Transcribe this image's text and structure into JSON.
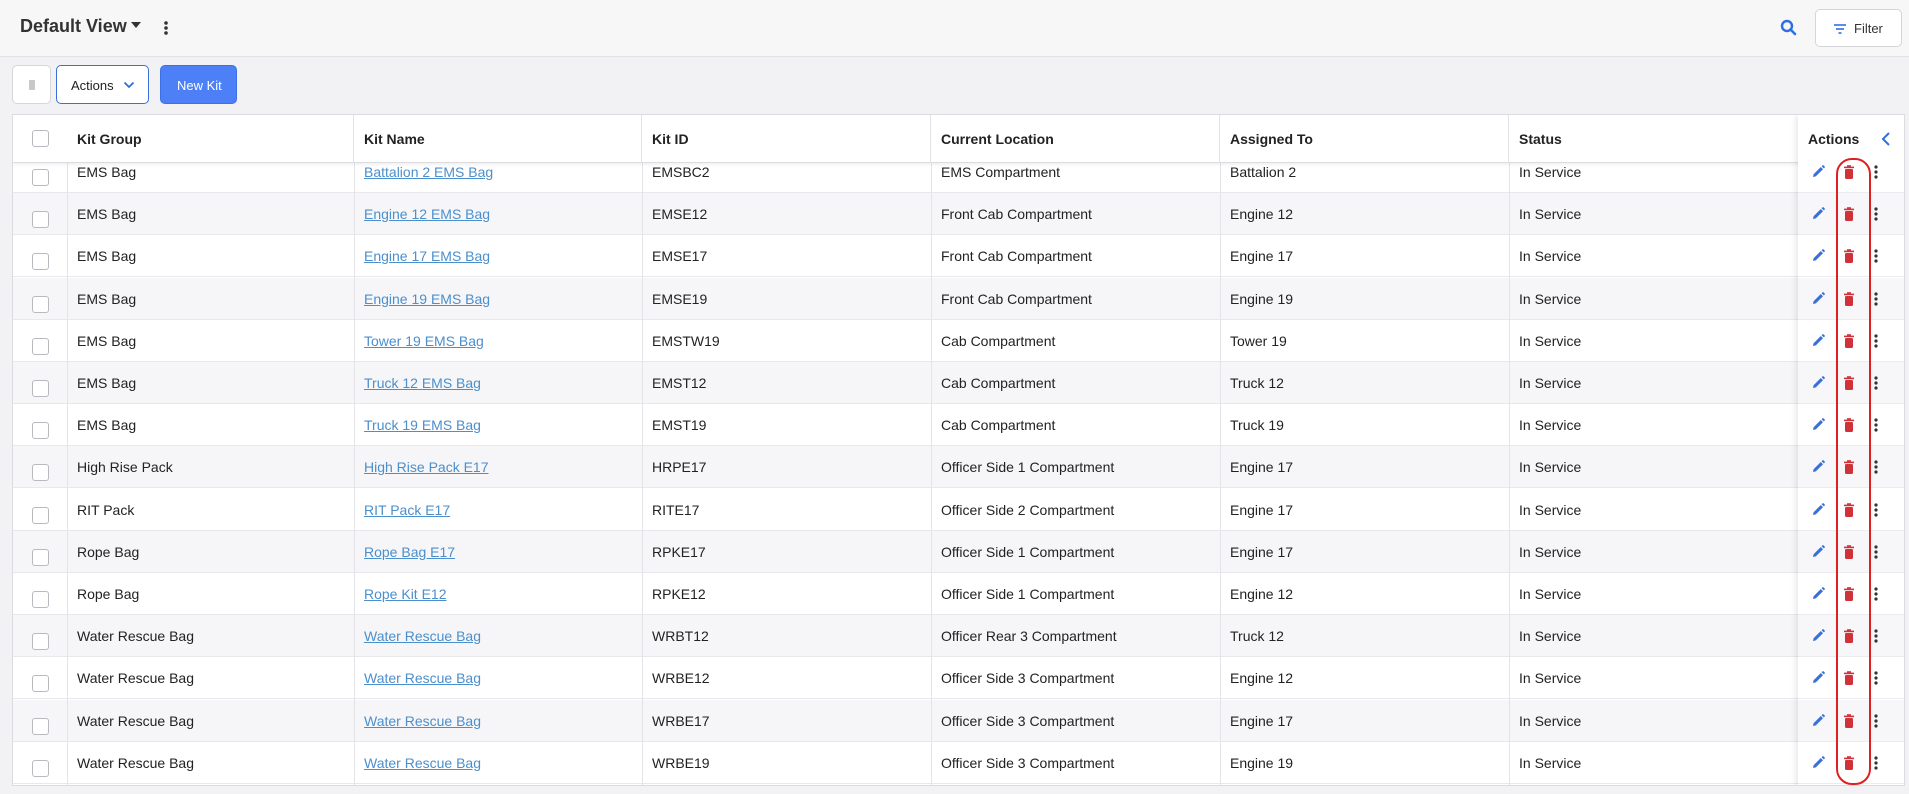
{
  "header": {
    "view_title": "Default View",
    "filter_label": "Filter"
  },
  "toolbar": {
    "actions_label": "Actions",
    "new_kit_label": "New Kit"
  },
  "table": {
    "columns": [
      "Kit Group",
      "Kit Name",
      "Kit ID",
      "Current Location",
      "Assigned To",
      "Status"
    ],
    "actions_header": "Actions",
    "rows": [
      {
        "group": "EMS Bag",
        "name": "Battalion 2 EMS Bag",
        "id": "EMSBC2",
        "location": "EMS Compartment",
        "assigned": "Battalion  2",
        "status": "In Service"
      },
      {
        "group": "EMS Bag",
        "name": "Engine 12 EMS Bag",
        "id": "EMSE12",
        "location": "Front Cab Compartment",
        "assigned": "Engine 12",
        "status": "In Service"
      },
      {
        "group": "EMS Bag",
        "name": "Engine 17 EMS Bag",
        "id": "EMSE17",
        "location": "Front Cab Compartment",
        "assigned": "Engine 17",
        "status": "In Service"
      },
      {
        "group": "EMS Bag",
        "name": "Engine 19 EMS Bag",
        "id": "EMSE19",
        "location": "Front Cab Compartment",
        "assigned": "Engine 19",
        "status": "In Service"
      },
      {
        "group": "EMS Bag",
        "name": "Tower 19 EMS Bag",
        "id": "EMSTW19",
        "location": "Cab Compartment",
        "assigned": "Tower 19",
        "status": "In Service"
      },
      {
        "group": "EMS Bag",
        "name": "Truck 12 EMS Bag",
        "id": "EMST12",
        "location": "Cab Compartment",
        "assigned": "Truck 12",
        "status": "In Service"
      },
      {
        "group": "EMS Bag",
        "name": "Truck 19 EMS Bag",
        "id": "EMST19",
        "location": "Cab Compartment",
        "assigned": "Truck 19",
        "status": "In Service"
      },
      {
        "group": "High Rise Pack",
        "name": "High Rise Pack E17",
        "id": "HRPE17",
        "location": "Officer Side 1 Compartment",
        "assigned": "Engine 17",
        "status": "In Service"
      },
      {
        "group": "RIT Pack",
        "name": "RIT Pack E17",
        "id": "RITE17",
        "location": "Officer Side 2 Compartment",
        "assigned": "Engine 17",
        "status": "In Service"
      },
      {
        "group": "Rope Bag",
        "name": "Rope Bag E17",
        "id": "RPKE17",
        "location": "Officer Side 1 Compartment",
        "assigned": "Engine 17",
        "status": "In Service"
      },
      {
        "group": "Rope Bag",
        "name": "Rope Kit E12",
        "id": "RPKE12",
        "location": "Officer Side 1 Compartment",
        "assigned": "Engine 12",
        "status": "In Service"
      },
      {
        "group": "Water Rescue Bag",
        "name": "Water Rescue Bag",
        "id": "WRBT12",
        "location": "Officer Rear 3 Compartment",
        "assigned": "Truck 12",
        "status": "In Service"
      },
      {
        "group": "Water Rescue Bag",
        "name": "Water Rescue Bag",
        "id": "WRBE12",
        "location": "Officer Side 3 Compartment",
        "assigned": "Engine 12",
        "status": "In Service"
      },
      {
        "group": "Water Rescue Bag",
        "name": "Water Rescue Bag",
        "id": "WRBE17",
        "location": "Officer Side 3 Compartment",
        "assigned": "Engine 17",
        "status": "In Service"
      },
      {
        "group": "Water Rescue Bag",
        "name": "Water Rescue Bag",
        "id": "WRBE19",
        "location": "Officer Side 3 Compartment",
        "assigned": "Engine 19",
        "status": "In Service"
      }
    ]
  },
  "colors": {
    "accent": "#4d7ff7",
    "link": "#4b8fcc",
    "delete": "#d0323a",
    "edit": "#3a6fd8",
    "highlight": "#e02020"
  },
  "icons": [
    "chevron-down-icon",
    "more-vertical-icon",
    "search-icon",
    "filter-icon",
    "pencil-icon",
    "trash-icon",
    "chevron-left-icon"
  ]
}
